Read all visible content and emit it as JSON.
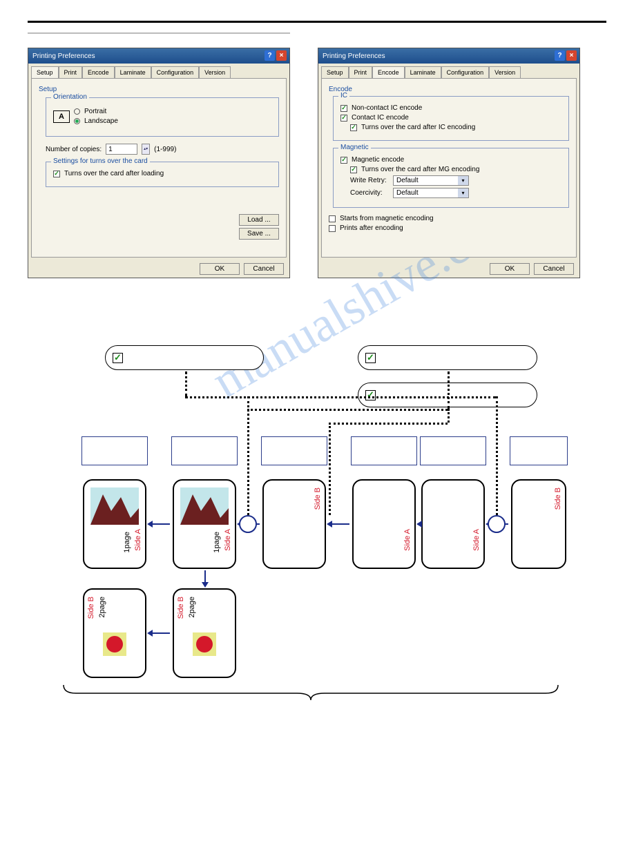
{
  "watermark": "manualshive.com",
  "dialog1": {
    "title": "Printing Preferences",
    "tabs": [
      "Setup",
      "Print",
      "Encode",
      "Laminate",
      "Configuration",
      "Version"
    ],
    "active_tab": "Setup",
    "setup_group": "Setup",
    "orientation_group": "Orientation",
    "orientation_letter": "A",
    "portrait": "Portrait",
    "landscape": "Landscape",
    "copies_label": "Number of copies:",
    "copies_value": "1",
    "copies_range": "(1-999)",
    "turns_group": "Settings for turns over the card",
    "turns_after_loading": "Turns over the card after loading",
    "load": "Load ...",
    "save": "Save ...",
    "ok": "OK",
    "cancel": "Cancel"
  },
  "dialog2": {
    "title": "Printing Preferences",
    "tabs": [
      "Setup",
      "Print",
      "Encode",
      "Laminate",
      "Configuration",
      "Version"
    ],
    "active_tab": "Encode",
    "encode_group": "Encode",
    "ic_group": "IC",
    "non_contact": "Non-contact IC encode",
    "contact": "Contact IC encode",
    "turns_ic": "Turns over the card after IC encoding",
    "mag_group": "Magnetic",
    "mag_encode": "Magnetic encode",
    "turns_mg": "Turns over the card after MG encoding",
    "write_retry": "Write Retry:",
    "coercivity": "Coercivity:",
    "default": "Default",
    "starts_mag": "Starts from magnetic encoding",
    "prints_after": "Prints after encoding",
    "ok": "OK",
    "cancel": "Cancel"
  },
  "pills": {
    "check": "✓"
  },
  "cards": {
    "sideA": "Side A",
    "sideB": "Side B",
    "page1": "1page",
    "page2": "2page"
  }
}
